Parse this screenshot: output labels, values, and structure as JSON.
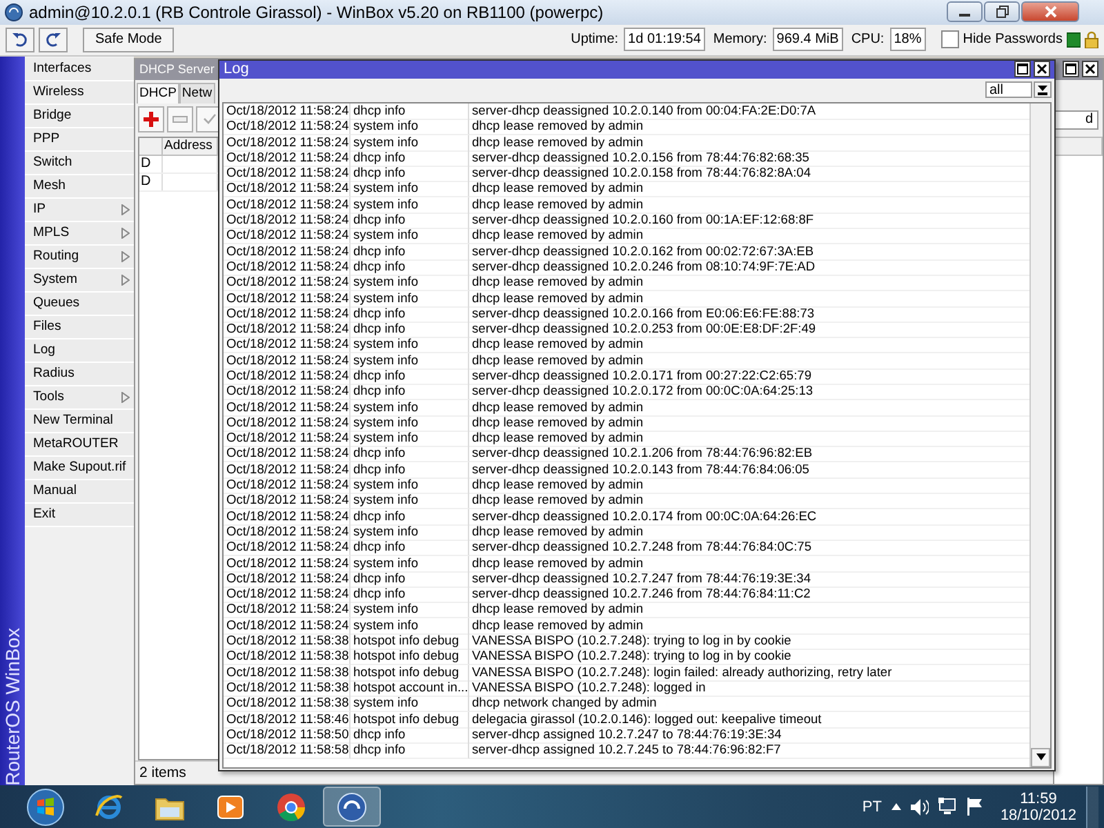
{
  "window": {
    "title": "admin@10.2.0.1 (RB Controle Girassol) - WinBox v5.20 on RB1100 (powerpc)"
  },
  "toolbar": {
    "safe_mode_button": "Safe Mode",
    "stats": [
      {
        "label": "Uptime:",
        "value": "1d 01:19:54"
      },
      {
        "label": "Memory:",
        "value": "969.4 MiB"
      },
      {
        "label": "CPU:",
        "value": "18%"
      }
    ],
    "hide_passwords": {
      "label": "Hide Passwords",
      "checked": false
    }
  },
  "side_banner": "RouterOS WinBox",
  "menu": [
    {
      "label": "Interfaces",
      "has_submenu": false
    },
    {
      "label": "Wireless",
      "has_submenu": false
    },
    {
      "label": "Bridge",
      "has_submenu": false
    },
    {
      "label": "PPP",
      "has_submenu": false
    },
    {
      "label": "Switch",
      "has_submenu": false
    },
    {
      "label": "Mesh",
      "has_submenu": false
    },
    {
      "label": "IP",
      "has_submenu": true
    },
    {
      "label": "MPLS",
      "has_submenu": true
    },
    {
      "label": "Routing",
      "has_submenu": true
    },
    {
      "label": "System",
      "has_submenu": true
    },
    {
      "label": "Queues",
      "has_submenu": false
    },
    {
      "label": "Files",
      "has_submenu": false
    },
    {
      "label": "Log",
      "has_submenu": false
    },
    {
      "label": "Radius",
      "has_submenu": false
    },
    {
      "label": "Tools",
      "has_submenu": true
    },
    {
      "label": "New Terminal",
      "has_submenu": false
    },
    {
      "label": "MetaROUTER",
      "has_submenu": false
    },
    {
      "label": "Make Supout.rif",
      "has_submenu": false
    },
    {
      "label": "Manual",
      "has_submenu": false
    },
    {
      "label": "Exit",
      "has_submenu": false
    }
  ],
  "dhcp_window": {
    "title": "DHCP Server",
    "tabs": [
      {
        "label": "DHCP",
        "selected": true
      },
      {
        "label": "Netw",
        "selected": false
      }
    ],
    "find_field": "d",
    "table": {
      "columns": [
        "Address"
      ],
      "rows": [
        {
          "flag": "D"
        },
        {
          "flag": "D"
        }
      ]
    },
    "status": "2 items"
  },
  "log_window": {
    "title": "Log",
    "filter": "all",
    "rows": [
      {
        "time": "Oct/18/2012 11:58:24",
        "topics": "dhcp info",
        "message": "server-dhcp deassigned 10.2.0.140 from 00:04:FA:2E:D0:7A"
      },
      {
        "time": "Oct/18/2012 11:58:24",
        "topics": "system info",
        "message": "dhcp lease removed by admin"
      },
      {
        "time": "Oct/18/2012 11:58:24",
        "topics": "system info",
        "message": "dhcp lease removed by admin"
      },
      {
        "time": "Oct/18/2012 11:58:24",
        "topics": "dhcp info",
        "message": "server-dhcp deassigned 10.2.0.156 from 78:44:76:82:68:35"
      },
      {
        "time": "Oct/18/2012 11:58:24",
        "topics": "dhcp info",
        "message": "server-dhcp deassigned 10.2.0.158 from 78:44:76:82:8A:04"
      },
      {
        "time": "Oct/18/2012 11:58:24",
        "topics": "system info",
        "message": "dhcp lease removed by admin"
      },
      {
        "time": "Oct/18/2012 11:58:24",
        "topics": "system info",
        "message": "dhcp lease removed by admin"
      },
      {
        "time": "Oct/18/2012 11:58:24",
        "topics": "dhcp info",
        "message": "server-dhcp deassigned 10.2.0.160 from 00:1A:EF:12:68:8F"
      },
      {
        "time": "Oct/18/2012 11:58:24",
        "topics": "system info",
        "message": "dhcp lease removed by admin"
      },
      {
        "time": "Oct/18/2012 11:58:24",
        "topics": "dhcp info",
        "message": "server-dhcp deassigned 10.2.0.162 from 00:02:72:67:3A:EB"
      },
      {
        "time": "Oct/18/2012 11:58:24",
        "topics": "dhcp info",
        "message": "server-dhcp deassigned 10.2.0.246 from 08:10:74:9F:7E:AD"
      },
      {
        "time": "Oct/18/2012 11:58:24",
        "topics": "system info",
        "message": "dhcp lease removed by admin"
      },
      {
        "time": "Oct/18/2012 11:58:24",
        "topics": "system info",
        "message": "dhcp lease removed by admin"
      },
      {
        "time": "Oct/18/2012 11:58:24",
        "topics": "dhcp info",
        "message": "server-dhcp deassigned 10.2.0.166 from E0:06:E6:FE:88:73"
      },
      {
        "time": "Oct/18/2012 11:58:24",
        "topics": "dhcp info",
        "message": "server-dhcp deassigned 10.2.0.253 from 00:0E:E8:DF:2F:49"
      },
      {
        "time": "Oct/18/2012 11:58:24",
        "topics": "system info",
        "message": "dhcp lease removed by admin"
      },
      {
        "time": "Oct/18/2012 11:58:24",
        "topics": "system info",
        "message": "dhcp lease removed by admin"
      },
      {
        "time": "Oct/18/2012 11:58:24",
        "topics": "dhcp info",
        "message": "server-dhcp deassigned 10.2.0.171 from 00:27:22:C2:65:79"
      },
      {
        "time": "Oct/18/2012 11:58:24",
        "topics": "dhcp info",
        "message": "server-dhcp deassigned 10.2.0.172 from 00:0C:0A:64:25:13"
      },
      {
        "time": "Oct/18/2012 11:58:24",
        "topics": "system info",
        "message": "dhcp lease removed by admin"
      },
      {
        "time": "Oct/18/2012 11:58:24",
        "topics": "system info",
        "message": "dhcp lease removed by admin"
      },
      {
        "time": "Oct/18/2012 11:58:24",
        "topics": "system info",
        "message": "dhcp lease removed by admin"
      },
      {
        "time": "Oct/18/2012 11:58:24",
        "topics": "dhcp info",
        "message": "server-dhcp deassigned 10.2.1.206 from 78:44:76:96:82:EB"
      },
      {
        "time": "Oct/18/2012 11:58:24",
        "topics": "dhcp info",
        "message": "server-dhcp deassigned 10.2.0.143 from 78:44:76:84:06:05"
      },
      {
        "time": "Oct/18/2012 11:58:24",
        "topics": "system info",
        "message": "dhcp lease removed by admin"
      },
      {
        "time": "Oct/18/2012 11:58:24",
        "topics": "system info",
        "message": "dhcp lease removed by admin"
      },
      {
        "time": "Oct/18/2012 11:58:24",
        "topics": "dhcp info",
        "message": "server-dhcp deassigned 10.2.0.174 from 00:0C:0A:64:26:EC"
      },
      {
        "time": "Oct/18/2012 11:58:24",
        "topics": "system info",
        "message": "dhcp lease removed by admin"
      },
      {
        "time": "Oct/18/2012 11:58:24",
        "topics": "dhcp info",
        "message": "server-dhcp deassigned 10.2.7.248 from 78:44:76:84:0C:75"
      },
      {
        "time": "Oct/18/2012 11:58:24",
        "topics": "system info",
        "message": "dhcp lease removed by admin"
      },
      {
        "time": "Oct/18/2012 11:58:24",
        "topics": "dhcp info",
        "message": "server-dhcp deassigned 10.2.7.247 from 78:44:76:19:3E:34"
      },
      {
        "time": "Oct/18/2012 11:58:24",
        "topics": "dhcp info",
        "message": "server-dhcp deassigned 10.2.7.246 from 78:44:76:84:11:C2"
      },
      {
        "time": "Oct/18/2012 11:58:24",
        "topics": "system info",
        "message": "dhcp lease removed by admin"
      },
      {
        "time": "Oct/18/2012 11:58:24",
        "topics": "system info",
        "message": "dhcp lease removed by admin"
      },
      {
        "time": "Oct/18/2012 11:58:38",
        "topics": "hotspot info debug",
        "message": "VANESSA BISPO (10.2.7.248): trying to log in by cookie"
      },
      {
        "time": "Oct/18/2012 11:58:38",
        "topics": "hotspot info debug",
        "message": "VANESSA BISPO (10.2.7.248): trying to log in by cookie"
      },
      {
        "time": "Oct/18/2012 11:58:38",
        "topics": "hotspot info debug",
        "message": "VANESSA BISPO (10.2.7.248): login failed: already authorizing, retry later"
      },
      {
        "time": "Oct/18/2012 11:58:38",
        "topics": "hotspot account in...",
        "message": "VANESSA BISPO (10.2.7.248): logged in"
      },
      {
        "time": "Oct/18/2012 11:58:38",
        "topics": "system info",
        "message": "dhcp network changed by admin"
      },
      {
        "time": "Oct/18/2012 11:58:46",
        "topics": "hotspot info debug",
        "message": "delegacia girassol (10.2.0.146): logged out: keepalive timeout"
      },
      {
        "time": "Oct/18/2012 11:58:50",
        "topics": "dhcp info",
        "message": "server-dhcp assigned 10.2.7.247 to 78:44:76:19:3E:34"
      },
      {
        "time": "Oct/18/2012 11:58:58",
        "topics": "dhcp info",
        "message": "server-dhcp assigned 10.2.7.245 to 78:44:76:96:82:F7"
      }
    ]
  },
  "taskbar": {
    "apps": [
      {
        "kind": "browser",
        "active": false
      },
      {
        "kind": "folder",
        "active": false
      },
      {
        "kind": "player",
        "active": false
      },
      {
        "kind": "chrome",
        "active": false
      },
      {
        "kind": "winbox",
        "active": true
      }
    ],
    "language": "PT",
    "clock": {
      "time": "11:59",
      "date": "18/10/2012"
    }
  }
}
